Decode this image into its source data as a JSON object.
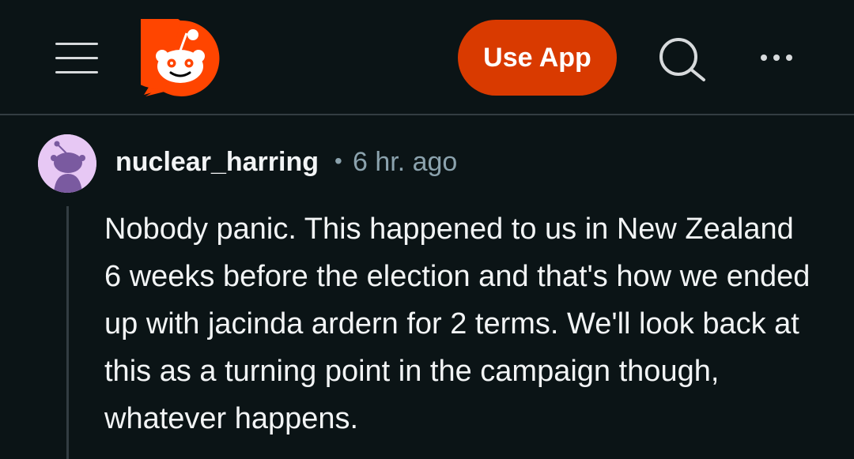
{
  "header": {
    "menu_icon": "hamburger-menu-icon",
    "logo_icon": "reddit-snoo-logo",
    "use_app_label": "Use App",
    "search_icon": "search-icon",
    "more_icon": "more-horizontal-icon",
    "colors": {
      "background": "#0b1416",
      "accent": "#d93a00",
      "logo": "#ff4500"
    }
  },
  "comment": {
    "avatar_icon": "snoo-avatar-icon",
    "username": "nuclear_harring",
    "separator": "•",
    "timestamp": "6 hr. ago",
    "body": "Nobody panic. This happened to us in New Zealand 6 weeks before the election and that's how we ended up with jacinda ardern for 2 terms. We'll look back at this as a turning point in the campaign though, whatever happens."
  }
}
